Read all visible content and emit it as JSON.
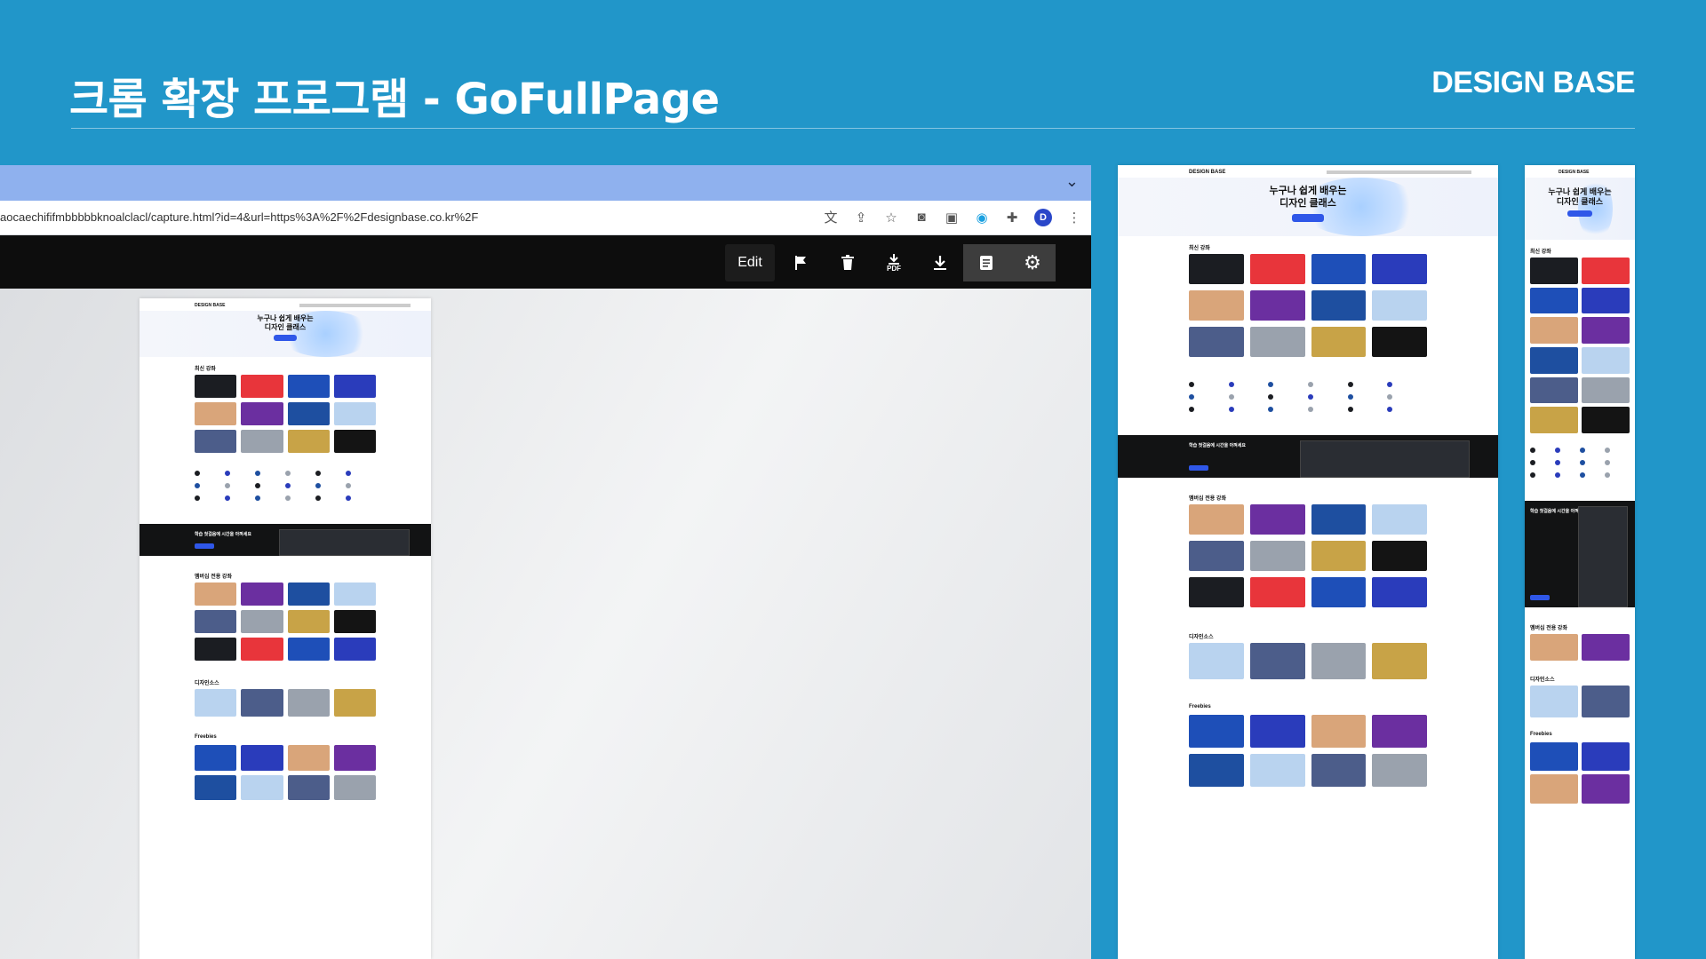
{
  "slide": {
    "title": "크롬 확장 프로그램 - GoFullPage",
    "brand": "DESIGN BASE"
  },
  "browser": {
    "url": "aocaechififmbbbbbknoalclacl/capture.html?id=4&url=https%3A%2F%2Fdesignbase.co.kr%2F",
    "profile_initial": "D",
    "toolbar": {
      "edit_label": "Edit",
      "pdf_label": "PDF"
    }
  },
  "preview_page": {
    "logo": "DESIGN BASE",
    "hero_line1": "누구나 쉽게 배우는",
    "hero_line2": "디자인 클래스",
    "band_title": "학습 첫걸음에 시간을 아껴세요",
    "section_latest": "최신 강좌",
    "section_member": "멤버십 전용 강좌",
    "section_resources": "디자인소스",
    "section_freebies": "Freebies"
  },
  "colors": {
    "background": "#2196c9",
    "tabstrip": "#8fb1ee",
    "toolbar": "#0d0d0d",
    "accent": "#2f57e8"
  },
  "thumb_palette": [
    "#1b1d22",
    "#e8353b",
    "#1e4fb8",
    "#2a3cbb",
    "#d9a57a",
    "#6b2fa0",
    "#1e4fa0",
    "#b9d3ef",
    "#4c5d8a",
    "#9aa2ad",
    "#c8a347",
    "#141414"
  ]
}
